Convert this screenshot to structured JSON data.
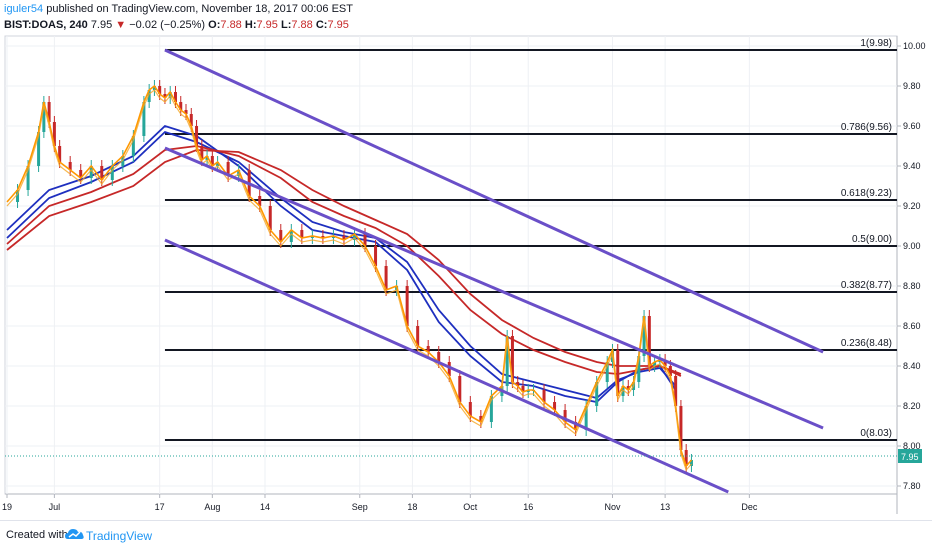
{
  "header": {
    "user": "iguler54",
    "published_text": "published on TradingView.com, November 18, 2017 00:06 EST",
    "symbol_text": "BIST:DOAS, 240",
    "last": "7.95",
    "down_arrow": "▼",
    "change": "−0.02 (−0.25%)",
    "o_label": "O:",
    "o_value": "7.88",
    "h_label": "H:",
    "h_value": "7.95",
    "l_label": "L:",
    "l_value": "7.88",
    "c_label": "C:",
    "c_value": "7.95"
  },
  "footer": {
    "created_with": "Created with",
    "brand": "TradingView",
    "logo_icon": "tradingview-cloud-icon"
  },
  "colors": {
    "down": "#c62828",
    "up": "#26a69a",
    "fib": "#131722",
    "channel": "#6a4fc8",
    "ema_blue": "#1e2fbf",
    "ema_red": "#c62828",
    "ema_orange": "#ff9800",
    "price_tag": "#26a69a"
  },
  "chart_data": {
    "type": "line",
    "title": "",
    "xlabel": "",
    "ylabel": "",
    "ylim": [
      7.76,
      10.05
    ],
    "x_ticks": [
      {
        "label": "19",
        "t": 0
      },
      {
        "label": "Jul",
        "t": 9
      },
      {
        "label": "17",
        "t": 29
      },
      {
        "label": "Aug",
        "t": 39
      },
      {
        "label": "14",
        "t": 49
      },
      {
        "label": "Sep",
        "t": 67
      },
      {
        "label": "18",
        "t": 77
      },
      {
        "label": "Oct",
        "t": 88
      },
      {
        "label": "16",
        "t": 99
      },
      {
        "label": "Nov",
        "t": 115
      },
      {
        "label": "13",
        "t": 125
      },
      {
        "label": "Dec",
        "t": 141
      }
    ],
    "y_ticks": [
      "7.80",
      "8.00",
      "8.20",
      "8.40",
      "8.60",
      "8.80",
      "9.00",
      "9.20",
      "9.40",
      "9.60",
      "9.80",
      "10.00"
    ],
    "fibonacci": [
      {
        "label": "1(9.98)",
        "value": 9.98
      },
      {
        "label": "0.786(9.56)",
        "value": 9.56
      },
      {
        "label": "0.618(9.23)",
        "value": 9.23
      },
      {
        "label": "0.5(9.00)",
        "value": 9.0
      },
      {
        "label": "0.382(8.77)",
        "value": 8.77
      },
      {
        "label": "0.236(8.48)",
        "value": 8.48
      },
      {
        "label": "0(8.03)",
        "value": 8.03
      }
    ],
    "channel": [
      {
        "name": "upper",
        "x": [
          30,
          155
        ],
        "y": [
          9.98,
          8.47
        ]
      },
      {
        "name": "middle",
        "x": [
          30,
          155
        ],
        "y": [
          9.49,
          8.09
        ]
      },
      {
        "name": "lower",
        "x": [
          30,
          137
        ],
        "y": [
          9.03,
          7.77
        ]
      }
    ],
    "series": [
      {
        "role": "price",
        "x": [
          0,
          2,
          4,
          6,
          7,
          8,
          9,
          10,
          12,
          14,
          16,
          18,
          20,
          22,
          24,
          26,
          27,
          28,
          29,
          30,
          31,
          32,
          33,
          34,
          35,
          36,
          37,
          38,
          39,
          40,
          42,
          44,
          46,
          48,
          50,
          52,
          54,
          56,
          58,
          60,
          62,
          64,
          66,
          68,
          70,
          72,
          74,
          76,
          78,
          80,
          82,
          84,
          86,
          88,
          90,
          92,
          94,
          95,
          96,
          97,
          98,
          99,
          100,
          102,
          104,
          106,
          108,
          110,
          112,
          114,
          115,
          116,
          117,
          118,
          119,
          120,
          121,
          122,
          123,
          124,
          125,
          126,
          127,
          128,
          129,
          130
        ],
        "y": [
          9.22,
          9.28,
          9.4,
          9.57,
          9.72,
          9.62,
          9.5,
          9.42,
          9.38,
          9.34,
          9.4,
          9.33,
          9.4,
          9.45,
          9.55,
          9.72,
          9.78,
          9.8,
          9.76,
          9.74,
          9.77,
          9.72,
          9.68,
          9.66,
          9.6,
          9.5,
          9.43,
          9.45,
          9.4,
          9.42,
          9.35,
          9.38,
          9.25,
          9.2,
          9.08,
          9.02,
          9.08,
          9.04,
          9.05,
          9.04,
          9.05,
          9.03,
          9.06,
          9.0,
          8.9,
          8.78,
          8.8,
          8.6,
          8.5,
          8.47,
          8.42,
          8.35,
          8.22,
          8.15,
          8.12,
          8.25,
          8.3,
          8.55,
          8.32,
          8.3,
          8.27,
          8.28,
          8.28,
          8.22,
          8.18,
          8.12,
          8.08,
          8.2,
          8.32,
          8.42,
          8.48,
          8.25,
          8.3,
          8.28,
          8.32,
          8.45,
          8.65,
          8.4,
          8.42,
          8.43,
          8.4,
          8.35,
          8.2,
          7.98,
          7.9,
          7.93
        ]
      },
      {
        "role": "ema",
        "color": "blue",
        "x": [
          0,
          8,
          16,
          24,
          30,
          36,
          44,
          52,
          58,
          64,
          70,
          76,
          82,
          88,
          94,
          100,
          106,
          112,
          116,
          120,
          124,
          127
        ],
        "y": [
          9.08,
          9.28,
          9.35,
          9.45,
          9.6,
          9.55,
          9.4,
          9.2,
          9.08,
          9.05,
          9.02,
          8.88,
          8.62,
          8.45,
          8.32,
          8.3,
          8.25,
          8.22,
          8.32,
          8.38,
          8.4,
          8.28
        ]
      },
      {
        "role": "ema",
        "color": "blue",
        "x": [
          0,
          8,
          16,
          24,
          30,
          36,
          44,
          52,
          58,
          64,
          70,
          76,
          82,
          88,
          94,
          100,
          106,
          112,
          116,
          120,
          124,
          127
        ],
        "y": [
          9.04,
          9.24,
          9.32,
          9.42,
          9.57,
          9.52,
          9.42,
          9.24,
          9.12,
          9.07,
          9.04,
          8.92,
          8.68,
          8.5,
          8.36,
          8.32,
          8.28,
          8.24,
          8.33,
          8.37,
          8.39,
          8.3
        ]
      },
      {
        "role": "ema",
        "color": "red",
        "x": [
          0,
          8,
          16,
          24,
          30,
          36,
          44,
          52,
          58,
          64,
          70,
          76,
          82,
          88,
          94,
          100,
          106,
          112,
          116,
          120,
          124,
          128
        ],
        "y": [
          9.01,
          9.2,
          9.27,
          9.36,
          9.48,
          9.5,
          9.45,
          9.34,
          9.22,
          9.15,
          9.09,
          9.0,
          8.85,
          8.68,
          8.56,
          8.48,
          8.42,
          8.37,
          8.36,
          8.38,
          8.4,
          8.35
        ]
      },
      {
        "role": "ema",
        "color": "red",
        "x": [
          0,
          8,
          16,
          24,
          30,
          36,
          44,
          52,
          58,
          64,
          70,
          76,
          82,
          88,
          94,
          100,
          106,
          112,
          116,
          120,
          124,
          128
        ],
        "y": [
          8.98,
          9.15,
          9.22,
          9.3,
          9.42,
          9.48,
          9.47,
          9.38,
          9.28,
          9.2,
          9.13,
          9.06,
          8.93,
          8.76,
          8.63,
          8.54,
          8.47,
          8.42,
          8.4,
          8.4,
          8.4,
          8.36
        ]
      }
    ],
    "last_price": 7.95,
    "last_price_label": "7.95"
  }
}
